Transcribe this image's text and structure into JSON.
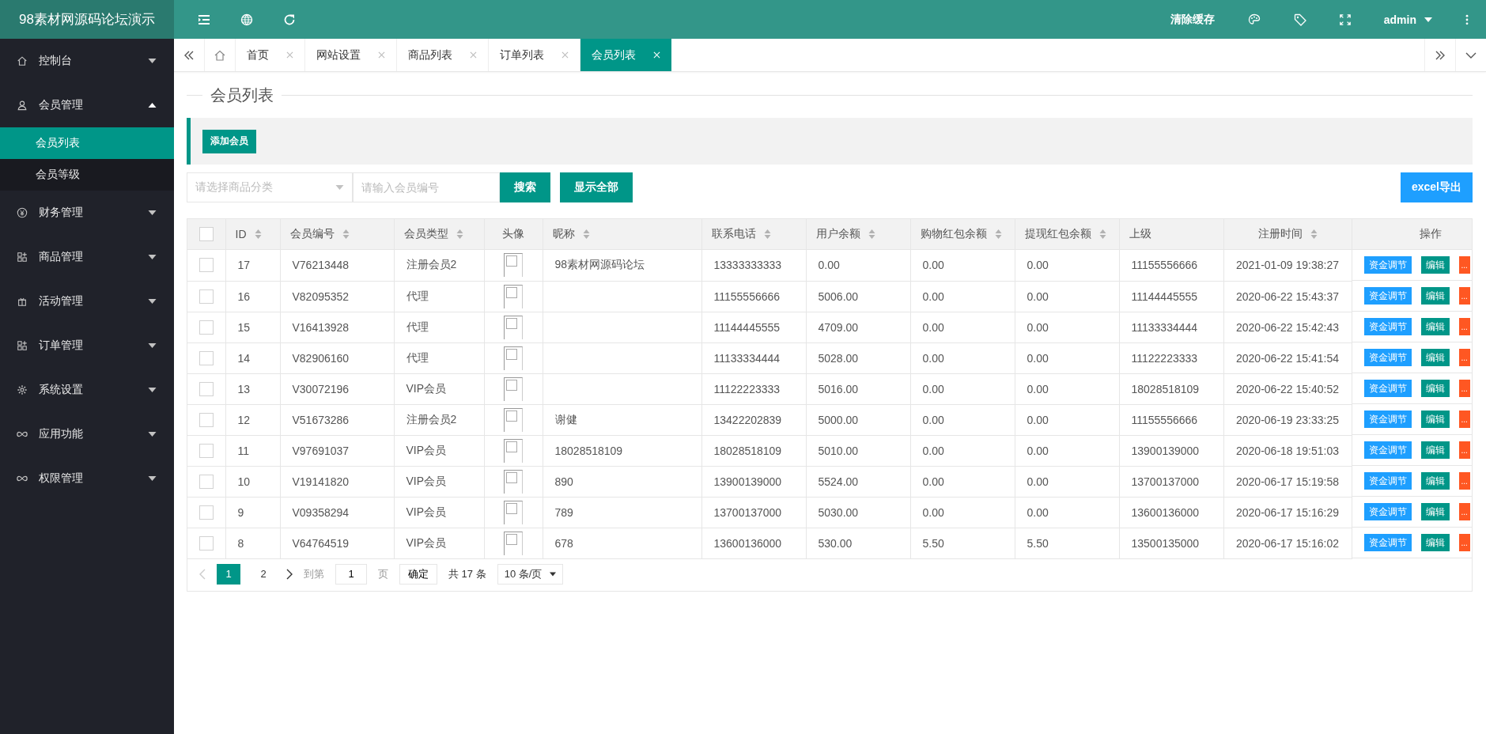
{
  "logo": "98素材网源码论坛演示",
  "topbar": {
    "clear_cache": "清除缓存",
    "user": "admin"
  },
  "sidebar": {
    "items": [
      {
        "label": "控制台",
        "expanded": false
      },
      {
        "label": "会员管理",
        "expanded": true,
        "children": [
          {
            "label": "会员列表",
            "selected": true
          },
          {
            "label": "会员等级",
            "selected": false
          }
        ]
      },
      {
        "label": "财务管理",
        "expanded": false
      },
      {
        "label": "商品管理",
        "expanded": false
      },
      {
        "label": "活动管理",
        "expanded": false
      },
      {
        "label": "订单管理",
        "expanded": false
      },
      {
        "label": "系统设置",
        "expanded": false
      },
      {
        "label": "应用功能",
        "expanded": false
      },
      {
        "label": "权限管理",
        "expanded": false
      }
    ]
  },
  "tabs": [
    {
      "label": "首页",
      "selected": false
    },
    {
      "label": "网站设置",
      "selected": false
    },
    {
      "label": "商品列表",
      "selected": false
    },
    {
      "label": "订单列表",
      "selected": false
    },
    {
      "label": "会员列表",
      "selected": true
    }
  ],
  "page_title": "会员列表",
  "toolbar": {
    "add_button": "添加会员"
  },
  "filters": {
    "category_placeholder": "请选择商品分类",
    "member_placeholder": "请输入会员编号",
    "search_button": "搜索",
    "show_all_button": "显示全部",
    "export_button": "excel导出"
  },
  "table": {
    "all_checked": false,
    "columns": [
      {
        "label": "ID",
        "sortable": true
      },
      {
        "label": "会员编号",
        "sortable": true
      },
      {
        "label": "会员类型",
        "sortable": true
      },
      {
        "label": "头像",
        "sortable": false
      },
      {
        "label": "昵称",
        "sortable": true
      },
      {
        "label": "联系电话",
        "sortable": true
      },
      {
        "label": "用户余额",
        "sortable": true
      },
      {
        "label": "购物红包余额",
        "sortable": true
      },
      {
        "label": "提现红包余额",
        "sortable": true
      },
      {
        "label": "上级",
        "sortable": false
      },
      {
        "label": "注册时间",
        "sortable": true
      },
      {
        "label": "操作",
        "sortable": false
      }
    ],
    "rows": [
      {
        "checked": false,
        "cells": [
          "17",
          "V76213448",
          "注册会员2",
          "",
          "98素材网源码论坛",
          "13333333333",
          "0.00",
          "0.00",
          "0.00",
          "11155556666",
          "2021-01-09 19:38:27"
        ],
        "actions": [
          "资金调节",
          "编辑",
          "..."
        ]
      },
      {
        "checked": false,
        "cells": [
          "16",
          "V82095352",
          "代理",
          "",
          "",
          "11155556666",
          "5006.00",
          "0.00",
          "0.00",
          "11144445555",
          "2020-06-22 15:43:37"
        ],
        "actions": [
          "资金调节",
          "编辑",
          "..."
        ]
      },
      {
        "checked": false,
        "cells": [
          "15",
          "V16413928",
          "代理",
          "",
          "",
          "11144445555",
          "4709.00",
          "0.00",
          "0.00",
          "11133334444",
          "2020-06-22 15:42:43"
        ],
        "actions": [
          "资金调节",
          "编辑",
          "..."
        ]
      },
      {
        "checked": false,
        "cells": [
          "14",
          "V82906160",
          "代理",
          "",
          "",
          "11133334444",
          "5028.00",
          "0.00",
          "0.00",
          "11122223333",
          "2020-06-22 15:41:54"
        ],
        "actions": [
          "资金调节",
          "编辑",
          "..."
        ]
      },
      {
        "checked": false,
        "cells": [
          "13",
          "V30072196",
          "VIP会员",
          "",
          "",
          "11122223333",
          "5016.00",
          "0.00",
          "0.00",
          "18028518109",
          "2020-06-22 15:40:52"
        ],
        "actions": [
          "资金调节",
          "编辑",
          "..."
        ]
      },
      {
        "checked": false,
        "cells": [
          "12",
          "V51673286",
          "注册会员2",
          "",
          "谢健",
          "13422202839",
          "5000.00",
          "0.00",
          "0.00",
          "11155556666",
          "2020-06-19 23:33:25"
        ],
        "actions": [
          "资金调节",
          "编辑",
          "..."
        ]
      },
      {
        "checked": false,
        "cells": [
          "11",
          "V97691037",
          "VIP会员",
          "",
          "18028518109",
          "18028518109",
          "5010.00",
          "0.00",
          "0.00",
          "13900139000",
          "2020-06-18 19:51:03"
        ],
        "actions": [
          "资金调节",
          "编辑",
          "..."
        ]
      },
      {
        "checked": false,
        "cells": [
          "10",
          "V19141820",
          "VIP会员",
          "",
          "890",
          "13900139000",
          "5524.00",
          "0.00",
          "0.00",
          "13700137000",
          "2020-06-17 15:19:58"
        ],
        "actions": [
          "资金调节",
          "编辑",
          "..."
        ]
      },
      {
        "checked": false,
        "cells": [
          "9",
          "V09358294",
          "VIP会员",
          "",
          "789",
          "13700137000",
          "5030.00",
          "0.00",
          "0.00",
          "13600136000",
          "2020-06-17 15:16:29"
        ],
        "actions": [
          "资金调节",
          "编辑",
          "..."
        ]
      },
      {
        "checked": false,
        "cells": [
          "8",
          "V64764519",
          "VIP会员",
          "",
          "678",
          "13600136000",
          "530.00",
          "5.50",
          "5.50",
          "13500135000",
          "2020-06-17 15:16:02"
        ],
        "actions": [
          "资金调节",
          "编辑",
          "..."
        ]
      }
    ]
  },
  "pagination": {
    "pages": [
      {
        "label": "1",
        "selected": true
      },
      {
        "label": "2",
        "selected": false
      }
    ],
    "prev_disabled": true,
    "goto_label": "到第",
    "goto_value": "1",
    "page_unit": "页",
    "confirm": "确定",
    "total": "共 17 条",
    "page_size": "10 条/页"
  }
}
